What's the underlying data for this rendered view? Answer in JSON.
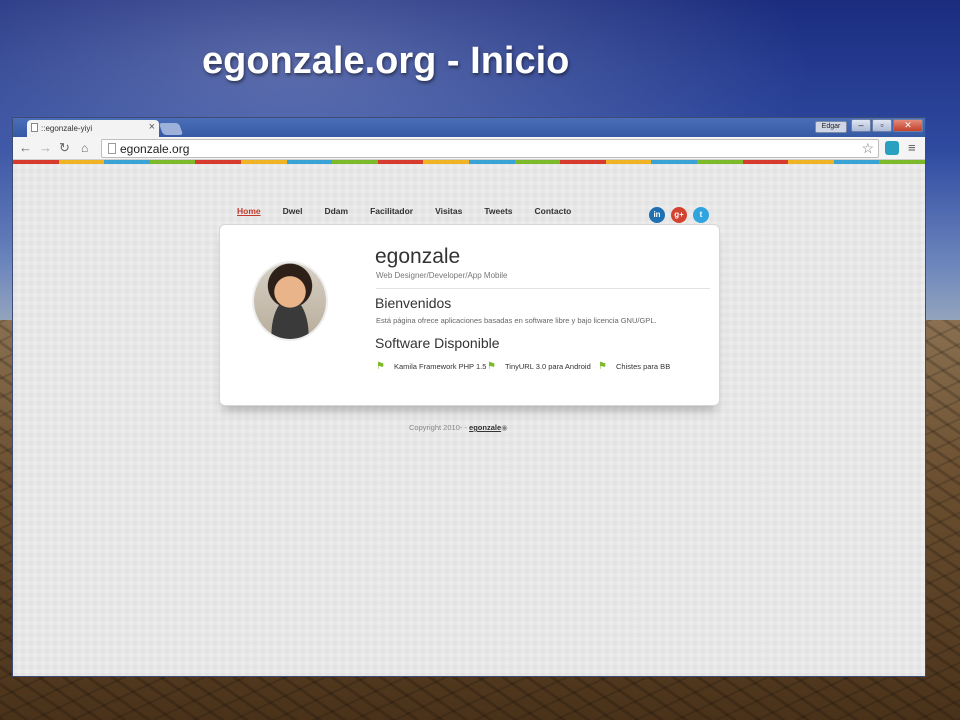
{
  "slide": {
    "title": "egonzale.org - Inicio"
  },
  "browser": {
    "tab_title": "::egonzale-yiyi",
    "tab_close": "×",
    "user_badge": "Edgar",
    "window_buttons": {
      "minimize": "–",
      "maximize": "▫",
      "close": "✕"
    },
    "nav": {
      "back": "←",
      "forward": "→",
      "reload": "↻",
      "home": "⌂"
    },
    "address": "egonzale.org",
    "star": "☆",
    "menu": "≡",
    "color_strip": [
      "#d63b2e",
      "#f0b323",
      "#3aa3d6",
      "#7cba2a",
      "#d63b2e",
      "#f0b323",
      "#3aa3d6",
      "#7cba2a",
      "#d63b2e",
      "#f0b323",
      "#3aa3d6",
      "#7cba2a",
      "#d63b2e",
      "#f0b323",
      "#3aa3d6",
      "#7cba2a",
      "#d63b2e",
      "#f0b323",
      "#3aa3d6",
      "#7cba2a"
    ]
  },
  "site": {
    "nav": [
      {
        "label": "Home"
      },
      {
        "label": "Dwel"
      },
      {
        "label": "Ddam"
      },
      {
        "label": "Facilitador"
      },
      {
        "label": "Visitas"
      },
      {
        "label": "Tweets"
      },
      {
        "label": "Contacto"
      }
    ],
    "social": {
      "linkedin": "in",
      "googleplus": "g+",
      "twitter": "t"
    },
    "profile": {
      "name": "egonzale",
      "role": "Web Designer/Developer/App Mobile"
    },
    "welcome": {
      "heading": "Bienvenidos",
      "text": "Está página ofrece aplicaciones basadas en software libre y bajo licencia GNU/GPL."
    },
    "software": {
      "heading": "Software Disponible",
      "items": [
        {
          "label": "Kamila Framework PHP 1.5"
        },
        {
          "label": "TinyURL 3.0 para Android"
        },
        {
          "label": "Chistes para BB"
        }
      ]
    },
    "footer": {
      "copyright": "Copyright 2010- - ",
      "link": "egonzale"
    }
  }
}
